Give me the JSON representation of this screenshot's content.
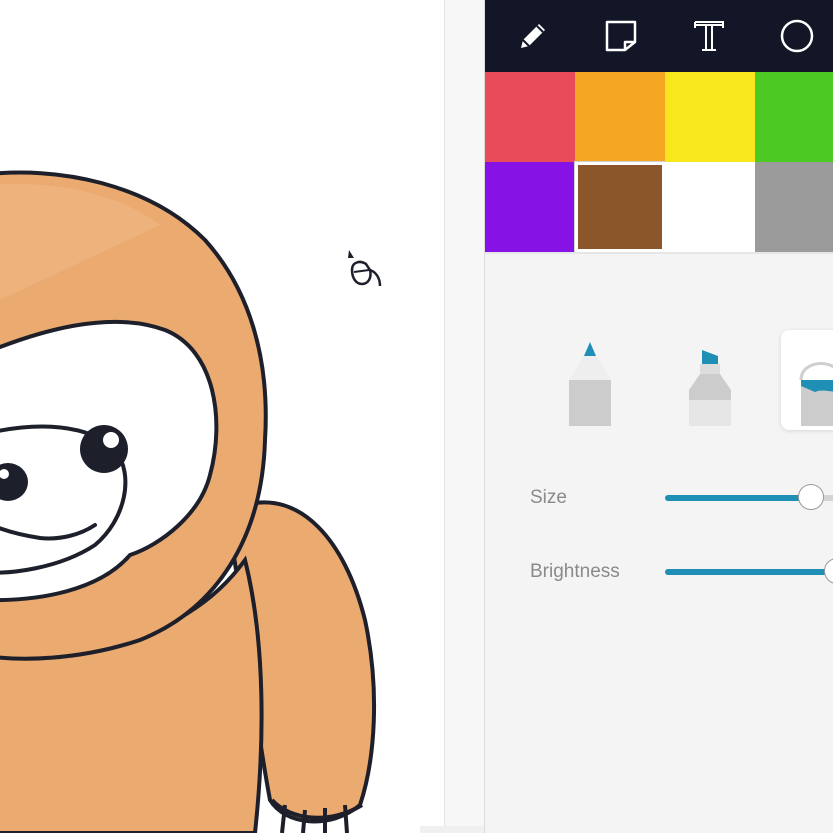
{
  "toolbar": {
    "tools": [
      {
        "name": "pencil-tool",
        "icon": "pencil-icon",
        "active": true
      },
      {
        "name": "sticky-note-tool",
        "icon": "sticky-note-icon",
        "active": false
      },
      {
        "name": "text-tool",
        "icon": "text-icon",
        "active": false
      },
      {
        "name": "shape-tool",
        "icon": "circle-icon",
        "active": false
      }
    ]
  },
  "palette": {
    "colors": [
      "#e94b5b",
      "#f5a623",
      "#f8e71c",
      "#4cc922",
      "#8612e6",
      "#8b572a",
      "#ffffff",
      "#9b9b9b"
    ],
    "selected": "#8b572a"
  },
  "brushes": [
    {
      "name": "pencil-brush",
      "icon": "pencil-brush-icon",
      "active": false
    },
    {
      "name": "marker-brush",
      "icon": "marker-brush-icon",
      "active": false
    },
    {
      "name": "fill-bucket-brush",
      "icon": "paint-bucket-icon",
      "active": true
    }
  ],
  "accent_color": "#1f8fb5",
  "size": {
    "label": "Size",
    "value": 0.73
  },
  "brightness": {
    "label": "Brightness",
    "value": 0.86
  },
  "cursor": {
    "icon": "paint-bucket-cursor-icon"
  }
}
